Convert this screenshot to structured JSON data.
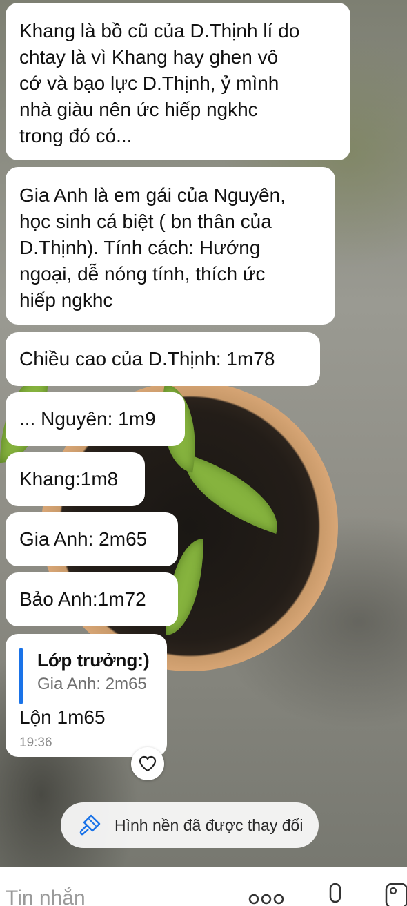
{
  "messages": [
    {
      "text": "Khang là bồ cũ của D.Thịnh lí do\nchtay là vì Khang hay ghen vô\ncớ và bạo lực D.Thịnh, ỷ mình\nnhà giàu nên ức hiếp ngkhc\ntrong đó có..."
    },
    {
      "text": "Gia Anh là em gái của Nguyên,\nhọc sinh cá biệt ( bn thân của\nD.Thịnh). Tính cách: Hướng\nngoại, dễ nóng tính, thích ức\nhiếp ngkhc"
    },
    {
      "text": "Chiều cao của D.Thịnh: 1m78"
    },
    {
      "text": "... Nguyên: 1m9"
    },
    {
      "text": "Khang:1m8"
    },
    {
      "text": "Gia Anh: 2m65"
    },
    {
      "text": "Bảo Anh:1m72"
    }
  ],
  "reply_message": {
    "quote_author": "Lớp trưởng:)",
    "quote_text": "Gia Anh: 2m65",
    "text": "Lộn 1m65",
    "time": "19:36"
  },
  "react_icon": "heart-icon",
  "system_notice": {
    "icon": "paintbrush-icon",
    "text": "Hình nền đã được thay đổi"
  },
  "composer": {
    "placeholder": "Tin nhắn",
    "icons": [
      "more-icon",
      "microphone-icon",
      "image-icon"
    ]
  },
  "colors": {
    "accent": "#1a73e8",
    "bubble": "#ffffff",
    "timestamp": "#8a8a8a"
  }
}
